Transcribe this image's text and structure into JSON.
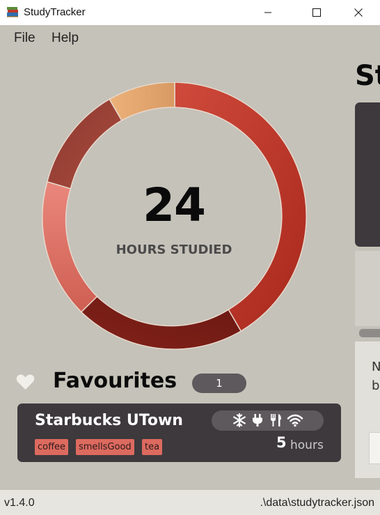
{
  "window": {
    "title": "StudyTracker"
  },
  "menu": {
    "file": "File",
    "help": "Help"
  },
  "summary": {
    "hours_value": "24",
    "hours_label": "HOURS STUDIED",
    "segment_colors": [
      "#c0392b",
      "#761c15",
      "#e07065",
      "#9e4035",
      "#e6a46a"
    ]
  },
  "favourites": {
    "title": "Favourites",
    "count": "1",
    "items": [
      {
        "name": "Starbucks UTown",
        "tags": [
          "coffee",
          "smellsGood",
          "tea"
        ],
        "hours": "5",
        "hours_unit": "hours",
        "amenity_icons": [
          "snowflake-icon",
          "plug-icon",
          "fork-knife-icon",
          "wifi-icon"
        ]
      }
    ]
  },
  "right_pane": {
    "title_fragment": "St",
    "text_line_1": "N",
    "text_line_2": "b"
  },
  "status": {
    "version": "v1.4.0",
    "data_path": ".\\data\\studytracker.json"
  }
}
